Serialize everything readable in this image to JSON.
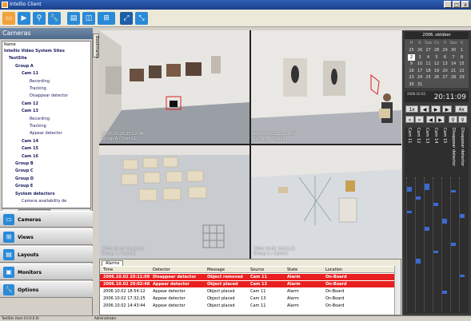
{
  "window": {
    "title": "Intellio Client",
    "min": "_",
    "max": "□",
    "close": "x"
  },
  "toolbar": {
    "buttons": [
      {
        "name": "monitor-icon",
        "glyph": "▭"
      },
      {
        "name": "play-icon",
        "glyph": "▶"
      },
      {
        "name": "search-icon",
        "glyph": "⚲"
      },
      {
        "name": "wrench-icon",
        "glyph": "🔧"
      },
      {
        "name": "presentation-icon",
        "glyph": "▤"
      },
      {
        "name": "window-icon",
        "glyph": "◫"
      },
      {
        "name": "grid-icon",
        "glyph": "⊞"
      },
      {
        "name": "fullscreen-icon",
        "glyph": "⤢"
      },
      {
        "name": "resize-icon",
        "glyph": "⤡"
      }
    ]
  },
  "left": {
    "header": "Cameras",
    "tree_col": "Name",
    "tree": [
      {
        "text": "Intellio Video System Sites",
        "bold": true,
        "indent": 2
      },
      {
        "text": "TestSite",
        "bold": true,
        "indent": 8
      },
      {
        "text": "Group A",
        "bold": true,
        "indent": 16
      },
      {
        "text": "Cam 11",
        "bold": true,
        "indent": 24
      },
      {
        "text": "Recording",
        "bold": false,
        "indent": 34
      },
      {
        "text": "Tracking",
        "bold": false,
        "indent": 34
      },
      {
        "text": "Disappear detector",
        "bold": false,
        "indent": 34
      },
      {
        "text": "Cam 12",
        "bold": true,
        "indent": 24
      },
      {
        "text": "Cam 13",
        "bold": true,
        "indent": 24
      },
      {
        "text": "Recording",
        "bold": false,
        "indent": 34
      },
      {
        "text": "Tracking",
        "bold": false,
        "indent": 34
      },
      {
        "text": "Appear detector",
        "bold": false,
        "indent": 34
      },
      {
        "text": "Cam 14",
        "bold": true,
        "indent": 24
      },
      {
        "text": "Cam 15",
        "bold": true,
        "indent": 24
      },
      {
        "text": "Cam 16",
        "bold": true,
        "indent": 24
      },
      {
        "text": "Group B",
        "bold": true,
        "indent": 16
      },
      {
        "text": "Group C",
        "bold": true,
        "indent": 16
      },
      {
        "text": "Group D",
        "bold": true,
        "indent": 16
      },
      {
        "text": "Group E",
        "bold": true,
        "indent": 16
      },
      {
        "text": "System detectors",
        "bold": true,
        "indent": 16
      },
      {
        "text": "Camera availability de",
        "bold": false,
        "indent": 24
      }
    ],
    "nav": [
      {
        "label": "Cameras",
        "icon": "camera-icon",
        "glyph": "▭"
      },
      {
        "label": "Views",
        "icon": "views-icon",
        "glyph": "⊞"
      },
      {
        "label": "Layouts",
        "icon": "layouts-icon",
        "glyph": "▤"
      },
      {
        "label": "Monitors",
        "icon": "monitors-icon",
        "glyph": "▣"
      },
      {
        "label": "Options",
        "icon": "options-icon",
        "glyph": "🔧"
      }
    ],
    "vtab": "Bookmarks"
  },
  "cams": [
    {
      "ts": "2006.10.02 20:12:48",
      "name": "Group A / Cam11"
    },
    {
      "ts": "2006.10.02 20:11:09",
      "name": "Group A / Cam11"
    },
    {
      "ts": "2006.10.02 15:40:28",
      "name": "Group A / Cam13"
    },
    {
      "ts": "2006.10.02 10:52:21",
      "name": "Group A / Cam14"
    }
  ],
  "calendar": {
    "month": "2006. október",
    "days_hdr": [
      "H",
      "K",
      "Sze",
      "Cs",
      "P",
      "Szo",
      "V"
    ],
    "days": [
      "25",
      "26",
      "27",
      "28",
      "29",
      "30",
      "1",
      "2",
      "3",
      "4",
      "5",
      "6",
      "7",
      "8",
      "9",
      "10",
      "11",
      "12",
      "13",
      "14",
      "15",
      "16",
      "17",
      "18",
      "19",
      "20",
      "21",
      "22",
      "23",
      "24",
      "25",
      "26",
      "27",
      "28",
      "29",
      "30",
      "31"
    ],
    "selected": "2"
  },
  "clock": {
    "date": "2006.10.02.",
    "time": "20:11:09"
  },
  "controls": {
    "row1": [
      "1x",
      "◀",
      "▶",
      "▶",
      "4x"
    ],
    "row2": [
      "«",
      "»",
      "◀",
      "▶",
      "⚲",
      "⚲"
    ]
  },
  "timeline": {
    "labels": [
      "Cam 11",
      "Cam 12",
      "Cam 13",
      "Cam 14",
      "Cam 15",
      "Disappear detector",
      "Disappear detector"
    ]
  },
  "alarms": {
    "tab": "Alarms",
    "headers": [
      "Time",
      "Detector",
      "Message",
      "Source",
      "State",
      "Location"
    ],
    "rows": [
      [
        "2006.10.02 20:11:09",
        "Disappear detector",
        "Object removed",
        "Cam 11",
        "Alarm",
        "On-Board"
      ],
      [
        "2006.10.02 20:02:48",
        "Appear detector",
        "Object placed",
        "Cam 13",
        "Alarm",
        "On-Board"
      ],
      [
        "2006.10.02 18:54:12",
        "Appear detector",
        "Object placed",
        "Cam 11",
        "Alarm",
        "On-Board"
      ],
      [
        "2006.10.02 17:32:25",
        "Appear detector",
        "Object placed",
        "Cam 13",
        "Alarm",
        "On-Board"
      ],
      [
        "2006.10.02 14:43:44",
        "Appear detector",
        "Object placed",
        "Cam 11",
        "Alarm",
        "On-Board"
      ]
    ],
    "highlight_rows": [
      0,
      1
    ]
  },
  "status": {
    "site": "TestSite (test 4.0.0.0.0)",
    "user": "Administrator"
  }
}
